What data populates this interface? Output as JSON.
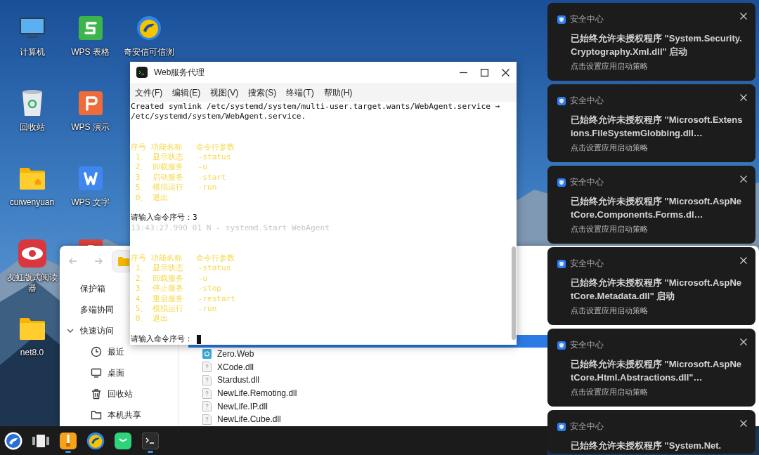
{
  "desktop_icon_columns": [
    [
      {
        "kind": "computer",
        "label": "计算机"
      },
      {
        "kind": "recycle",
        "label": "回收站"
      },
      {
        "kind": "home-folder",
        "label": "cuiwenyuan"
      },
      {
        "kind": "reader",
        "label": "友虹版式阅读器"
      },
      {
        "kind": "folder",
        "label": "net8.0"
      }
    ],
    [
      {
        "kind": "sheet",
        "label": "WPS 表格"
      },
      {
        "kind": "slides",
        "label": "WPS 演示"
      },
      {
        "kind": "writer",
        "label": "WPS 文字"
      },
      {
        "kind": "pdf"
      }
    ],
    [
      {
        "kind": "browser",
        "label": "奇安信可信浏"
      }
    ]
  ],
  "file_manager": {
    "sidebar": [
      {
        "kind": "plain",
        "label": "保护箱"
      },
      {
        "kind": "plain",
        "label": "多端协同"
      },
      {
        "kind": "group",
        "label": "快速访问",
        "expanded": true
      },
      {
        "kind": "clock",
        "label": "最近"
      },
      {
        "kind": "monitor",
        "label": "桌面"
      },
      {
        "kind": "trash",
        "label": "回收站"
      },
      {
        "kind": "folder",
        "label": "本机共享"
      }
    ],
    "files": [
      {
        "kind": "app",
        "name": "Zero.Web"
      },
      {
        "kind": "file",
        "name": "XCode.dll"
      },
      {
        "kind": "file",
        "name": "Stardust.dll"
      },
      {
        "kind": "file",
        "name": "NewLife.Remoting.dll"
      },
      {
        "kind": "file",
        "name": "NewLife.IP.dll"
      },
      {
        "kind": "file",
        "name": "NewLife.Cube.dll"
      }
    ]
  },
  "terminal": {
    "title": "Web服务代理",
    "menu": [
      "文件(F)",
      "编辑(E)",
      "视图(V)",
      "搜索(S)",
      "终端(T)",
      "帮助(H)"
    ],
    "lines": [
      {
        "kind": "output",
        "text": "Created symlink /etc/systemd/system/multi-user.target.wants/WebAgent.service → /etc/systemd/system/WebAgent.service."
      },
      {
        "kind": "blank"
      },
      {
        "kind": "blank"
      },
      {
        "kind": "menu",
        "text": "序号 功能名称   命令行参数"
      },
      {
        "kind": "menu",
        "text": " 1、 显示状态   -status"
      },
      {
        "kind": "menu",
        "text": " 2、 卸载服务   -u"
      },
      {
        "kind": "menu",
        "text": " 3、 启动服务   -start"
      },
      {
        "kind": "menu",
        "text": " 5、 模拟运行   -run"
      },
      {
        "kind": "menu",
        "text": " 0、 退出"
      },
      {
        "kind": "blank"
      },
      {
        "kind": "prompt",
        "text": "请输入命令序号：3",
        "cursor": false
      },
      {
        "kind": "log",
        "text": "13:43:27.990 01 N - systemd.Start WebAgent"
      },
      {
        "kind": "blank"
      },
      {
        "kind": "blank"
      },
      {
        "kind": "menu",
        "text": "序号 功能名称   命令行参数"
      },
      {
        "kind": "menu",
        "text": " 1、 显示状态   -status"
      },
      {
        "kind": "menu",
        "text": " 2、 卸载服务   -u"
      },
      {
        "kind": "menu",
        "text": " 3、 停止服务   -stop"
      },
      {
        "kind": "menu",
        "text": " 4、 重启服务   -restart"
      },
      {
        "kind": "menu",
        "text": " 5、 模拟运行   -run"
      },
      {
        "kind": "menu",
        "text": " 0、 退出"
      },
      {
        "kind": "blank"
      },
      {
        "kind": "prompt",
        "text": "请输入命令序号：",
        "cursor": true
      }
    ]
  },
  "notifications": [
    {
      "app": "安全中心",
      "message": "已始终允许未授权程序 \"System.Security.Cryptography.Xml.dll\" 启动",
      "action": "点击设置应用启动策略"
    },
    {
      "app": "安全中心",
      "message": "已始终允许未授权程序 \"Microsoft.Extensions.FileSystemGlobbing.dll…",
      "action": "点击设置应用启动策略"
    },
    {
      "app": "安全中心",
      "message": "已始终允许未授权程序 \"Microsoft.AspNetCore.Components.Forms.dl…",
      "action": "点击设置应用启动策略"
    },
    {
      "app": "安全中心",
      "message": "已始终允许未授权程序 \"Microsoft.AspNetCore.Metadata.dll\" 启动",
      "action": "点击设置应用启动策略"
    },
    {
      "app": "安全中心",
      "message": "已始终允许未授权程序 \"Microsoft.AspNetCore.Html.Abstractions.dll\"…",
      "action": "点击设置应用启动策略"
    },
    {
      "app": "安全中心",
      "message": "已始终允许未授权程序 \"System.Net."
    }
  ],
  "taskbar": [
    {
      "kind": "launcher",
      "running": false
    },
    {
      "kind": "multitask",
      "running": false
    },
    {
      "kind": "archive",
      "running": true
    },
    {
      "kind": "browser",
      "running": false
    },
    {
      "kind": "store",
      "running": false
    },
    {
      "kind": "terminal",
      "running": true
    }
  ]
}
